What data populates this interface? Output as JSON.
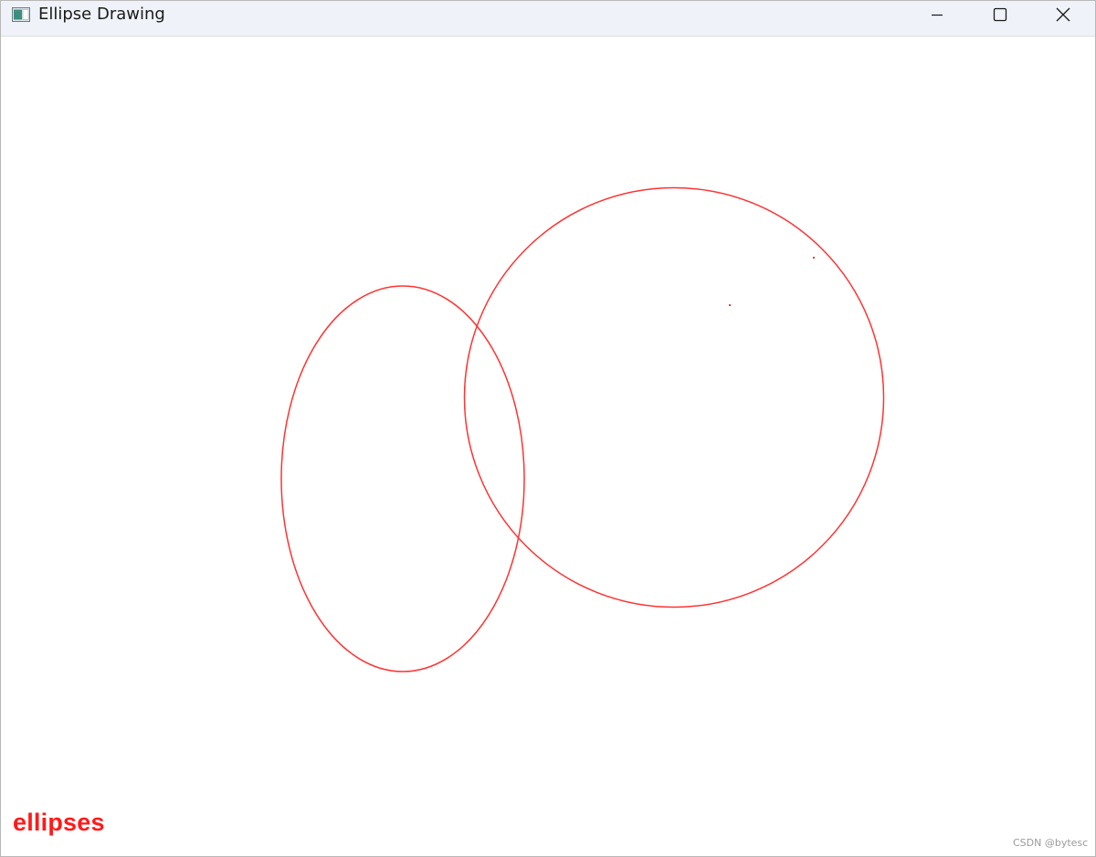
{
  "window": {
    "title": "Ellipse Drawing",
    "app_icon": "app-window-icon",
    "controls": {
      "minimize_icon": "minimize-icon",
      "maximize_icon": "maximize-icon",
      "close_icon": "close-icon"
    }
  },
  "canvas": {
    "background": "#ffffff",
    "stroke_color": "#ff3333",
    "label": "ellipses",
    "label_color": "#ff1a1a",
    "shapes": [
      {
        "name": "ellipse-left",
        "kind": "ellipse"
      },
      {
        "name": "circle-right",
        "kind": "circle"
      }
    ]
  },
  "watermark": {
    "text": "CSDN @bytesc"
  }
}
